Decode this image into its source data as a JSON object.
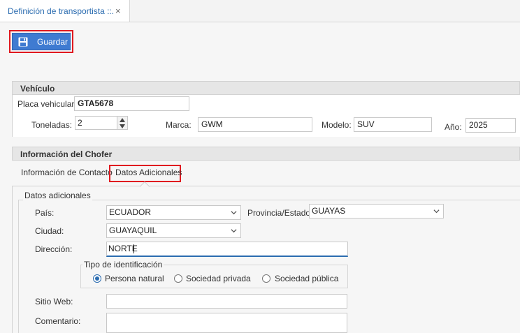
{
  "tab": {
    "title": "Definición de transportista ::.",
    "close_glyph": "×"
  },
  "toolbar": {
    "save_label": "Guardar"
  },
  "vehiculo": {
    "header": "Vehículo",
    "placa_label": "Placa vehicular:",
    "placa_value": "GTA5678",
    "toneladas_label": "Toneladas:",
    "toneladas_value": "2",
    "marca_label": "Marca:",
    "marca_value": "GWM",
    "modelo_label": "Modelo:",
    "modelo_value": "SUV",
    "anio_label": "Año:",
    "anio_value": "2025"
  },
  "chofer": {
    "header": "Información del Chofer",
    "tabs": [
      {
        "label": "Información de Contacto"
      },
      {
        "label": "Datos Adicionales"
      }
    ],
    "datos": {
      "group_title": "Datos adicionales",
      "pais_label": "País:",
      "pais_value": "ECUADOR",
      "provincia_label": "Provincia/Estado:",
      "provincia_value": "GUAYAS",
      "ciudad_label": "Ciudad:",
      "ciudad_value": "GUAYAQUIL",
      "direccion_label": "Dirección:",
      "direccion_value": "NORTE",
      "tipo_id_title": "Tipo de identificación",
      "radio_options": [
        "Persona natural",
        "Sociedad privada",
        "Sociedad pública"
      ],
      "selected_option": "Persona natural",
      "sitio_web_label": "Sitio Web:",
      "sitio_web_value": "",
      "comentario_label": "Comentario:",
      "comentario_value": ""
    }
  },
  "colors": {
    "accent": "#3f7bd1",
    "highlight": "#e0191f",
    "focus": "#2b6cb0"
  }
}
